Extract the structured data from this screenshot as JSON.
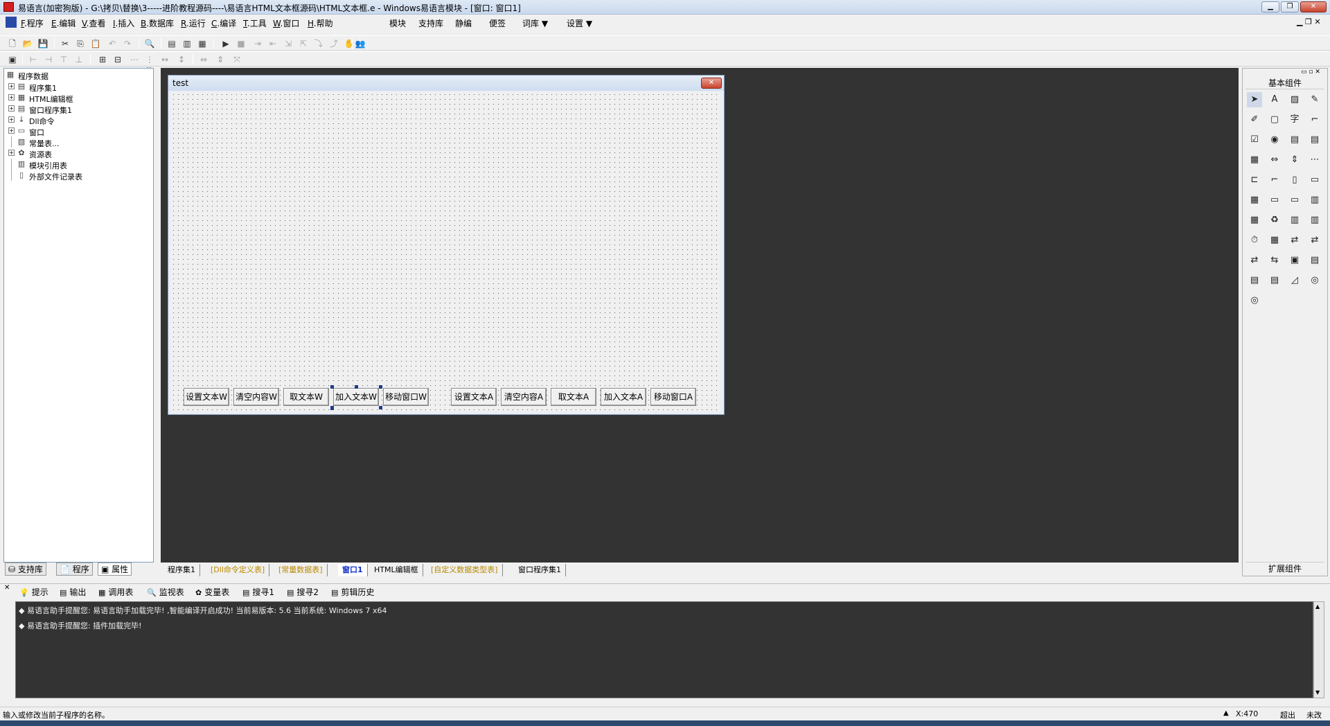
{
  "window": {
    "title": "易语言(加密狗版) - G:\\拷贝\\替换\\3-----进阶教程源码----\\易语言HTML文本框源码\\HTML文本框.e - Windows易语言模块 - [窗口: 窗口1]",
    "controls": [
      "▁",
      "❐",
      "✕"
    ]
  },
  "menu": {
    "items": [
      {
        "key": "F",
        "label": ".程序"
      },
      {
        "key": "E",
        "label": ".编辑"
      },
      {
        "key": "V",
        "label": ".查看"
      },
      {
        "key": "I",
        "label": ".插入"
      },
      {
        "key": "B",
        "label": ".数据库"
      },
      {
        "key": "R",
        "label": ".运行"
      },
      {
        "key": "C",
        "label": ".编译"
      },
      {
        "key": "T",
        "label": ".工具"
      },
      {
        "key": "W",
        "label": ".窗口"
      },
      {
        "key": "H",
        "label": ".帮助"
      }
    ],
    "extra": [
      "模块",
      "支持库",
      "静编",
      "便签",
      "词库 ▼",
      "设置 ▼"
    ]
  },
  "tree": {
    "root": "程序数据",
    "items": [
      "程序集1",
      "HTML编辑框",
      "窗口程序集1",
      "Dll命令",
      "窗口",
      "常量表...",
      "资源表",
      "模块引用表",
      "外部文件记录表"
    ]
  },
  "left_tabs": [
    "支持库",
    "程序",
    "属性"
  ],
  "form": {
    "title": "test",
    "buttons": [
      "设置文本W",
      "清空内容W",
      "取文本W",
      "加入文本W",
      "移动窗口W",
      "设置文本A",
      "清空内容A",
      "取文本A",
      "加入文本A",
      "移动窗口A"
    ]
  },
  "right_panel": {
    "header": "基本组件",
    "footer": "扩展组件"
  },
  "doc_tabs": [
    "程序集1",
    "[Dll命令定义表]",
    "[常量数据表]",
    "窗口1",
    "HTML编辑框",
    "[自定义数据类型表]",
    "窗口程序集1"
  ],
  "output_tabs": [
    "提示",
    "输出",
    "调用表",
    "监视表",
    "变量表",
    "搜寻1",
    "搜寻2",
    "剪辑历史"
  ],
  "output_lines": [
    "易语言助手提醒您: 易语言助手加载完毕! ,智能编译开启成功! 当前易版本: 5.6  当前系统: Windows 7 x64",
    "易语言助手提醒您: 插件加载完毕!"
  ],
  "status": {
    "hint": "输入或修改当前子程序的名称。",
    "coord": "X:470",
    "mode": "超出",
    "state": "未改"
  }
}
